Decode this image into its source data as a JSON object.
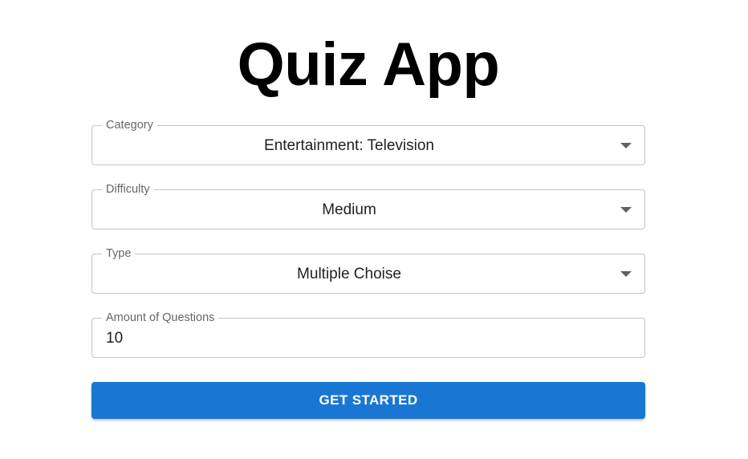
{
  "app": {
    "title": "Quiz App"
  },
  "form": {
    "category": {
      "label": "Category",
      "value": "Entertainment: Television"
    },
    "difficulty": {
      "label": "Difficulty",
      "value": "Medium"
    },
    "type": {
      "label": "Type",
      "value": "Multiple Choise"
    },
    "amount": {
      "label": "Amount of Questions",
      "value": "10"
    },
    "submit_label": "GET STARTED"
  },
  "colors": {
    "accent": "#1976d2",
    "border": "#c4c4c4",
    "label": "#666666"
  },
  "icons": {
    "select_caret": "arrow-drop-down-icon"
  }
}
